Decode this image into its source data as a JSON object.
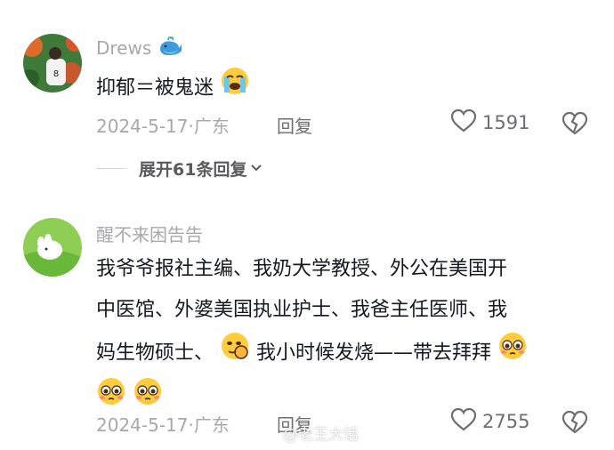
{
  "comments": [
    {
      "username": "Drews",
      "text": "抑郁＝被鬼迷",
      "date": "2024-5-17",
      "location": "广东",
      "reply_label": "回复",
      "likes": "1591",
      "expand_label": "展开61条回复"
    },
    {
      "username": "醒不来困告告",
      "line1": "我爷爷报社主编、我奶大学教授、外公在美国开",
      "line2": "中医馆、外婆美国执业护士、我爸主任医师、我",
      "line3a": "妈生物硕士、",
      "line3b": "我小时候发烧——带去拜拜",
      "date": "2024-5-17",
      "location": "广东",
      "reply_label": "回复",
      "likes": "2755"
    }
  ],
  "watermark": "@老王大话",
  "icons": [
    "whale-emoji",
    "crying-emoji",
    "heart-icon",
    "broken-heart-icon",
    "chevron-down-icon",
    "sneaky-emoji",
    "pleading-emoji",
    "weibo-icon"
  ]
}
